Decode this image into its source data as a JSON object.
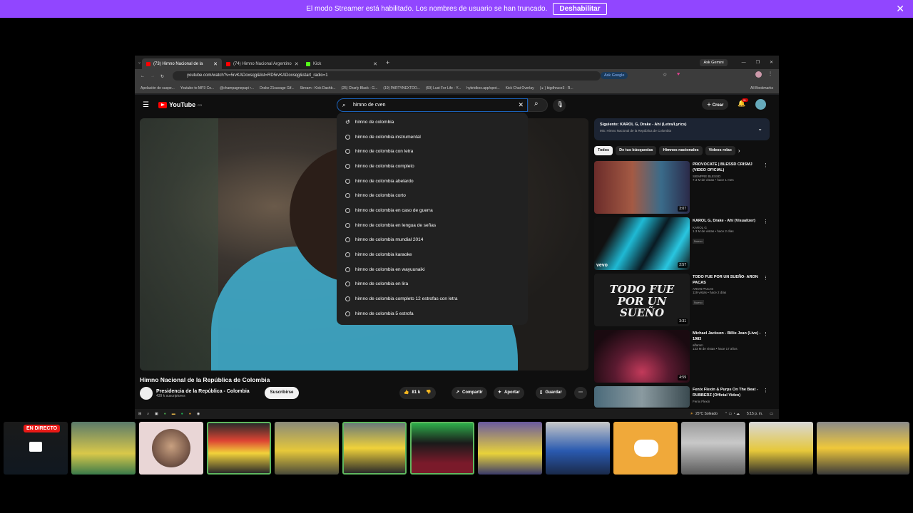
{
  "banner": {
    "message": "El modo Streamer está habilitado. Los nombres de usuario se han truncado.",
    "disable_label": "Deshabilitar"
  },
  "browser": {
    "tabs": [
      {
        "label": "(73) Himno Nacional de la",
        "active": true
      },
      {
        "label": "(74) Himno Nacional Argentino",
        "active": false
      },
      {
        "label": "Kick",
        "active": false
      }
    ],
    "ask_gemini": "Ask Gemini",
    "url": "youtube.com/watch?v=5rvKADoxsqg&list=RD5rvKADoxsqg&start_radio=1",
    "ask_google": "Ask Google",
    "bookmarks": [
      "Apelación de suspe...",
      "Youtube to MP3 Co...",
      "@champagnepapi •...",
      "Drake 21savage Gif...",
      "Stream - Kick Dashb...",
      "(25) Charly Black - G...",
      "(19) PARTYNEXTDO...",
      "(69) Lust For Life - Y...",
      "hybridbox.app/spot...",
      "Kick Chat Overlay",
      "( ▸ ) bigdhruce3 - R..."
    ],
    "all_bookmarks": "All Bookmarks"
  },
  "youtube": {
    "logo": "YouTube",
    "logo_region": "CO",
    "search_value": "himno de cven",
    "create_label": "Crear",
    "notif_count": "9+",
    "suggestions": [
      "himno de colombia",
      "himno de colombia instrumental",
      "himno de colombia con letra",
      "himno de colombia completo",
      "himno de colombia abelardo",
      "himno de colombia corto",
      "himno de colombia en caso de guerra",
      "himno de colombia en lengua de señas",
      "himno de colombia mundial 2014",
      "himno de colombia karaoke",
      "himno de colombia en wayuunaiki",
      "himno de colombia en lira",
      "himno de colombia completo 12 estrofas con letra",
      "himno de colombia 5 estrofa"
    ],
    "video_title": "Himno Nacional de la República de Colombia",
    "channel_name": "Presidencia de la República - Colombia",
    "channel_subs": "439 k suscriptores",
    "subscribe_label": "Suscribirse",
    "likes": "81 k",
    "share_label": "Compartir",
    "clip_label": "Aportar",
    "save_label": "Guardar",
    "upnext_title": "Siguiente: KAROL G, Drake - Ahí (Letra/Lyrics)",
    "upnext_sub": "Mix: Himno Nacional de la República de Colombia",
    "chips": [
      "Todos",
      "De tus búsquedas",
      "Himnos nacionales",
      "Videos relac"
    ],
    "recommendations": [
      {
        "title": "PROVOCATE | BLESSD CRISMJ (VIDEO OFICIAL)",
        "channel": "SIEMPRE BLESSD",
        "views": "7.3 M de vistas • hace 1 mes",
        "duration": "3:07",
        "badge": ""
      },
      {
        "title": "KAROL G, Drake - Ahí (Visualizer)",
        "channel": "KAROL G",
        "views": "1.3 M de vistas • hace 2 días",
        "duration": "2:57",
        "badge": "Nuevo"
      },
      {
        "title": "TODO FUE POR UN SUEÑO- ARON PACAS",
        "channel": "ARON PACAS",
        "views": "119 vistas • hace 2 días",
        "duration": "3:31",
        "badge": "Nuevo"
      },
      {
        "title": "Michael Jackson - Billie Jean (Live) - 1983",
        "channel": "alfamm",
        "views": "133 M de vistas • hace 17 años",
        "duration": "4:59",
        "badge": ""
      },
      {
        "title": "Fenix Flexin & Purps On The Beat - RUBBERZ (Official Video)",
        "channel": "Fenix Flexin",
        "views": "",
        "duration": "",
        "badge": ""
      }
    ],
    "thumb_text": "TODO FUE POR UN SUEÑO",
    "vevo": "vevo"
  },
  "taskbar": {
    "weather": "25°C Soleado",
    "time": "5:15 p. m."
  },
  "strip": {
    "live_label": "EN DIRECTO"
  }
}
